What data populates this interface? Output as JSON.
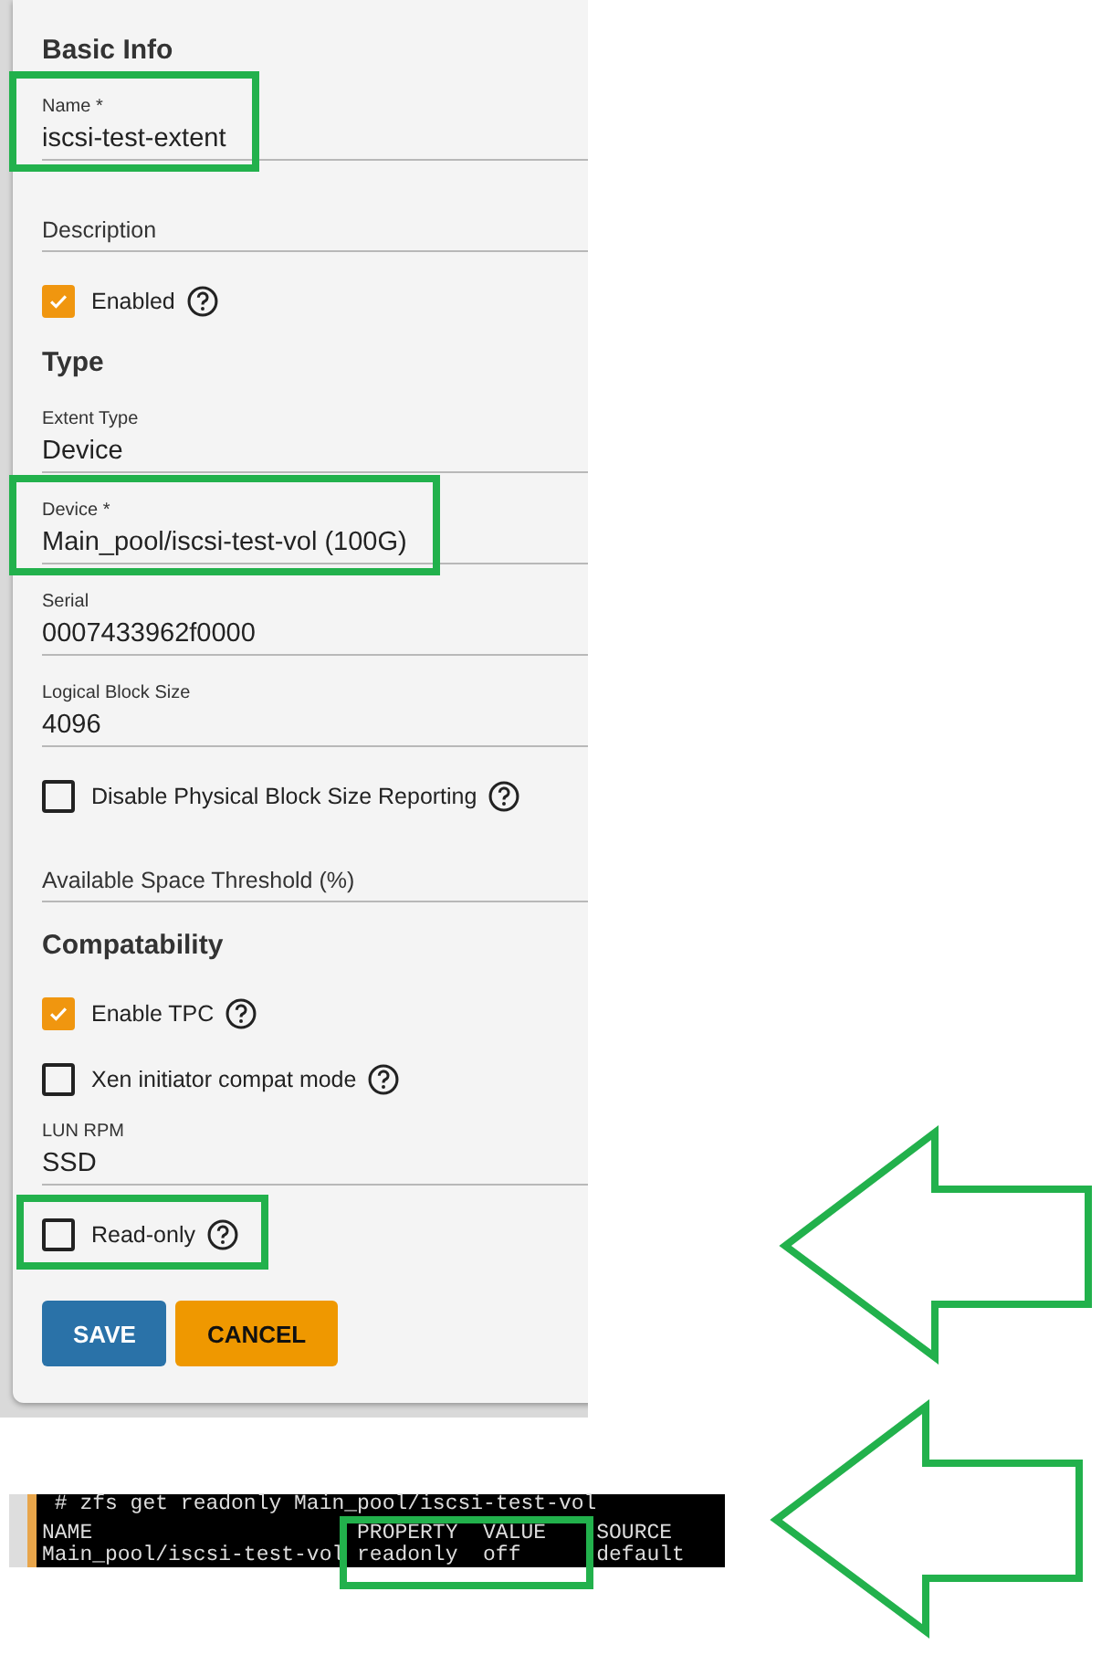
{
  "form": {
    "sections": [
      {
        "title": "Basic Info",
        "fields": [
          {
            "kind": "input",
            "label": "Name *",
            "value": "iscsi-test-extent",
            "highlighted": true
          },
          {
            "kind": "input",
            "placeholder": "Description",
            "highlighted": false
          },
          {
            "kind": "checkbox",
            "label": "Enabled",
            "checked": true,
            "highlighted": false
          }
        ]
      },
      {
        "title": "Type",
        "fields": [
          {
            "kind": "input",
            "label": "Extent Type",
            "value": "Device",
            "highlighted": false
          },
          {
            "kind": "input",
            "label": "Device *",
            "value": "Main_pool/iscsi-test-vol (100G)",
            "highlighted": true
          },
          {
            "kind": "input",
            "label": "Serial",
            "value": "0007433962f0000",
            "highlighted": false
          },
          {
            "kind": "input",
            "label": "Logical Block Size",
            "value": "4096",
            "highlighted": false
          },
          {
            "kind": "checkbox",
            "label": "Disable Physical Block Size Reporting",
            "checked": false,
            "highlighted": false
          },
          {
            "kind": "input",
            "placeholder": "Available Space Threshold (%)",
            "highlighted": false
          }
        ]
      },
      {
        "title": "Compatability",
        "fields": [
          {
            "kind": "checkbox",
            "label": "Enable TPC",
            "checked": true,
            "highlighted": false
          },
          {
            "kind": "checkbox",
            "label": "Xen initiator compat mode",
            "checked": false,
            "highlighted": false
          },
          {
            "kind": "input",
            "label": "LUN RPM",
            "value": "SSD",
            "highlighted": false
          },
          {
            "kind": "checkbox",
            "label": "Read-only",
            "checked": false,
            "highlighted": true
          }
        ]
      }
    ],
    "buttons": [
      {
        "label": "SAVE",
        "kind": "primary"
      },
      {
        "label": "CANCEL",
        "kind": "cancel"
      }
    ]
  },
  "terminal": {
    "command": " # zfs get readonly Main_pool/iscsi-test-vol",
    "columns": [
      "NAME",
      "PROPERTY",
      "VALUE",
      "SOURCE"
    ],
    "rows": [
      [
        "Main_pool/iscsi-test-vol",
        "readonly",
        "off",
        "default"
      ]
    ],
    "highlighted": true
  }
}
